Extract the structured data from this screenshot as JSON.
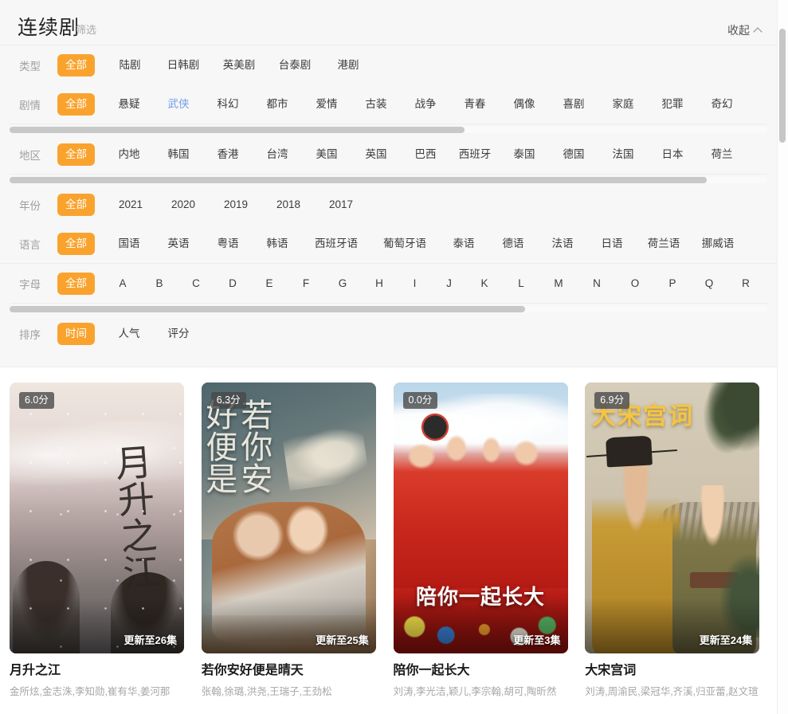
{
  "header": {
    "title": "连续剧",
    "subtitle": "筛选",
    "collapse_label": "收起",
    "collapse_icon": "chevron-up-icon"
  },
  "filters": [
    {
      "key": "type",
      "label": "类型",
      "options": [
        "全部",
        "陆剧",
        "日韩剧",
        "英美剧",
        "台泰剧",
        "港剧"
      ],
      "selected": "全部",
      "hovered": null,
      "scroll": null
    },
    {
      "key": "genre",
      "label": "剧情",
      "options": [
        "全部",
        "悬疑",
        "武侠",
        "科幻",
        "都市",
        "爱情",
        "古装",
        "战争",
        "青春",
        "偶像",
        "喜剧",
        "家庭",
        "犯罪",
        "奇幻"
      ],
      "selected": "全部",
      "hovered": "武侠",
      "scroll": {
        "thumb_percent": 60
      }
    },
    {
      "key": "region",
      "label": "地区",
      "options": [
        "全部",
        "内地",
        "韩国",
        "香港",
        "台湾",
        "美国",
        "英国",
        "巴西",
        "西班牙",
        "泰国",
        "德国",
        "法国",
        "日本",
        "荷兰"
      ],
      "selected": "全部",
      "hovered": null,
      "scroll": {
        "thumb_percent": 92
      }
    },
    {
      "key": "year",
      "label": "年份",
      "options": [
        "全部",
        "2021",
        "2020",
        "2019",
        "2018",
        "2017"
      ],
      "selected": "全部",
      "hovered": null,
      "scroll": null
    },
    {
      "key": "language",
      "label": "语言",
      "options": [
        "全部",
        "国语",
        "英语",
        "粤语",
        "韩语",
        "西班牙语",
        "葡萄牙语",
        "泰语",
        "德语",
        "法语",
        "日语",
        "荷兰语",
        "挪威语"
      ],
      "selected": "全部",
      "hovered": null,
      "scroll": null
    },
    {
      "key": "letter",
      "label": "字母",
      "options": [
        "全部",
        "A",
        "B",
        "C",
        "D",
        "E",
        "F",
        "G",
        "H",
        "I",
        "J",
        "K",
        "L",
        "M",
        "N",
        "O",
        "P",
        "Q",
        "R"
      ],
      "selected": "全部",
      "hovered": null,
      "scroll": {
        "thumb_percent": 68
      }
    },
    {
      "key": "sort",
      "label": "排序",
      "options": [
        "时间",
        "人气",
        "评分"
      ],
      "selected": "时间",
      "hovered": null,
      "scroll": null
    }
  ],
  "cards": [
    {
      "title": "月升之江",
      "score": "6.0分",
      "episodes": "更新至26集",
      "actors": "金所炫,金志洙,李知勋,崔有华,姜河那",
      "poster_text": "月升之江"
    },
    {
      "title": "若你安好便是晴天",
      "score": "6.3分",
      "episodes": "更新至25集",
      "actors": "张翰,徐璐,洪尧,王瑞子,王劲松",
      "poster_text": "若你安好便是晴天"
    },
    {
      "title": "陪你一起长大",
      "score": "0.0分",
      "episodes": "更新至3集",
      "actors": "刘涛,李光洁,颖儿,李宗翰,胡可,陶昕然",
      "poster_text": "陪你一起长大"
    },
    {
      "title": "大宋宫词",
      "score": "6.9分",
      "episodes": "更新至24集",
      "actors": "刘涛,周渝民,梁冠华,齐溪,归亚蕾,赵文瑄",
      "poster_text": "大宋宫词"
    }
  ],
  "colors": {
    "accent": "#f9a32e",
    "hover_link": "#6f9de9",
    "panel_bg": "#f7f7f7",
    "label_text": "#a0a0a0",
    "option_text": "#3b3b3b",
    "scrollbar_thumb": "#c6c6c6"
  },
  "scrollbars": {
    "vertical_thumb_top_percent": 4,
    "vertical_thumb_height_percent": 16
  }
}
